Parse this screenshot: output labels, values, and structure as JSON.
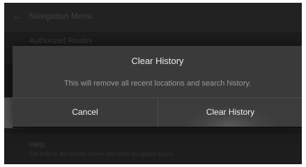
{
  "background": {
    "header_title": "Navigation Menu",
    "rows": [
      {
        "label": "Authorized Routes",
        "sub": ""
      },
      {
        "label": "",
        "sub": ""
      },
      {
        "label": "Help",
        "sub": "Get help on the current screen and other navigation topics"
      }
    ]
  },
  "dialog": {
    "title": "Clear History",
    "message": "This will remove all recent locations and search history.",
    "cancel_label": "Cancel",
    "confirm_label": "Clear History"
  },
  "colors": {
    "dialog_bg": "#3a3a3a",
    "screen_bg": "#1a1a1a",
    "text_primary": "#ededed",
    "text_secondary": "#9a9a9a"
  }
}
